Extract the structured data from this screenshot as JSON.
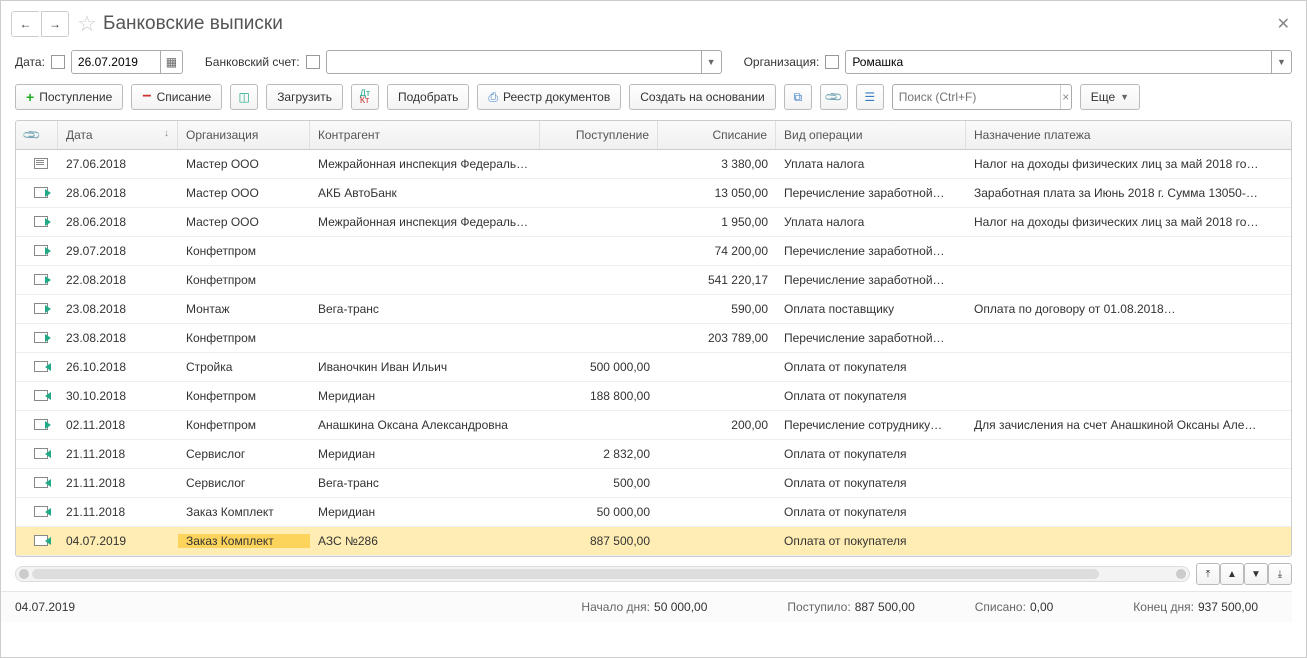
{
  "header": {
    "title": "Банковские выписки"
  },
  "filters": {
    "date_label": "Дата:",
    "date_value": "26.07.2019",
    "account_label": "Банковский счет:",
    "account_value": "",
    "org_label": "Организация:",
    "org_value": "Ромашка"
  },
  "toolbar": {
    "income": "Поступление",
    "expense": "Списание",
    "load": "Загрузить",
    "pick": "Подобрать",
    "registry": "Реестр документов",
    "create_based": "Создать на основании",
    "search_placeholder": "Поиск (Ctrl+F)",
    "more": "Еще"
  },
  "columns": {
    "date": "Дата",
    "org": "Организация",
    "contragent": "Контрагент",
    "income": "Поступление",
    "expense": "Списание",
    "op_type": "Вид операции",
    "purpose": "Назначение платежа"
  },
  "rows": [
    {
      "icon": "plain",
      "date": "27.06.2018",
      "org": "Мастер ООО",
      "contragent": "Межрайонная инспекция Федеральной…",
      "income": "",
      "expense": "3 380,00",
      "op": "Уплата налога",
      "purpose": "Налог на доходы физических лиц за май 2018 го…"
    },
    {
      "icon": "out",
      "date": "28.06.2018",
      "org": "Мастер ООО",
      "contragent": "АКБ АвтоБанк",
      "income": "",
      "expense": "13 050,00",
      "op": "Перечисление заработной…",
      "purpose": "Заработная плата за Июнь 2018 г. Сумма 13050-…"
    },
    {
      "icon": "out",
      "date": "28.06.2018",
      "org": "Мастер ООО",
      "contragent": "Межрайонная инспекция Федеральной…",
      "income": "",
      "expense": "1 950,00",
      "op": "Уплата налога",
      "purpose": "Налог на доходы физических лиц за май 2018 го…"
    },
    {
      "icon": "out",
      "date": "29.07.2018",
      "org": "Конфетпром",
      "contragent": "",
      "income": "",
      "expense": "74 200,00",
      "op": "Перечисление заработной…",
      "purpose": ""
    },
    {
      "icon": "out",
      "date": "22.08.2018",
      "org": "Конфетпром",
      "contragent": "",
      "income": "",
      "expense": "541 220,17",
      "op": "Перечисление заработной…",
      "purpose": ""
    },
    {
      "icon": "out",
      "date": "23.08.2018",
      "org": "Монтаж",
      "contragent": "Вега-транс",
      "income": "",
      "expense": "590,00",
      "op": "Оплата поставщику",
      "purpose": "Оплата по договору от 01.08.2018…"
    },
    {
      "icon": "out",
      "date": "23.08.2018",
      "org": "Конфетпром",
      "contragent": "",
      "income": "",
      "expense": "203 789,00",
      "op": "Перечисление заработной…",
      "purpose": ""
    },
    {
      "icon": "in",
      "date": "26.10.2018",
      "org": "Стройка",
      "contragent": "Иваночкин Иван Ильич",
      "income": "500 000,00",
      "expense": "",
      "op": "Оплата от покупателя",
      "purpose": ""
    },
    {
      "icon": "in",
      "date": "30.10.2018",
      "org": "Конфетпром",
      "contragent": "Меридиан",
      "income": "188 800,00",
      "expense": "",
      "op": "Оплата от покупателя",
      "purpose": ""
    },
    {
      "icon": "out",
      "date": "02.11.2018",
      "org": "Конфетпром",
      "contragent": "Анашкина Оксана Александровна",
      "income": "",
      "expense": "200,00",
      "op": "Перечисление сотруднику…",
      "purpose": "Для зачисления на счет Анашкиной Оксаны Але…"
    },
    {
      "icon": "in",
      "date": "21.11.2018",
      "org": "Сервислог",
      "contragent": "Меридиан",
      "income": "2 832,00",
      "expense": "",
      "op": "Оплата от покупателя",
      "purpose": ""
    },
    {
      "icon": "in",
      "date": "21.11.2018",
      "org": "Сервислог",
      "contragent": "Вега-транс",
      "income": "500,00",
      "expense": "",
      "op": "Оплата от покупателя",
      "purpose": ""
    },
    {
      "icon": "in",
      "date": "21.11.2018",
      "org": "Заказ Комплект",
      "contragent": "Меридиан",
      "income": "50 000,00",
      "expense": "",
      "op": "Оплата от покупателя",
      "purpose": ""
    },
    {
      "icon": "in",
      "date": "04.07.2019",
      "org": "Заказ Комплект",
      "contragent": "АЗС №286",
      "income": "887 500,00",
      "expense": "",
      "op": "Оплата от покупателя",
      "purpose": "",
      "selected": true
    }
  ],
  "status": {
    "date": "04.07.2019",
    "start_label": "Начало дня:",
    "start_value": "50 000,00",
    "in_label": "Поступило:",
    "in_value": "887 500,00",
    "out_label": "Списано:",
    "out_value": "0,00",
    "end_label": "Конец дня:",
    "end_value": "937 500,00"
  }
}
